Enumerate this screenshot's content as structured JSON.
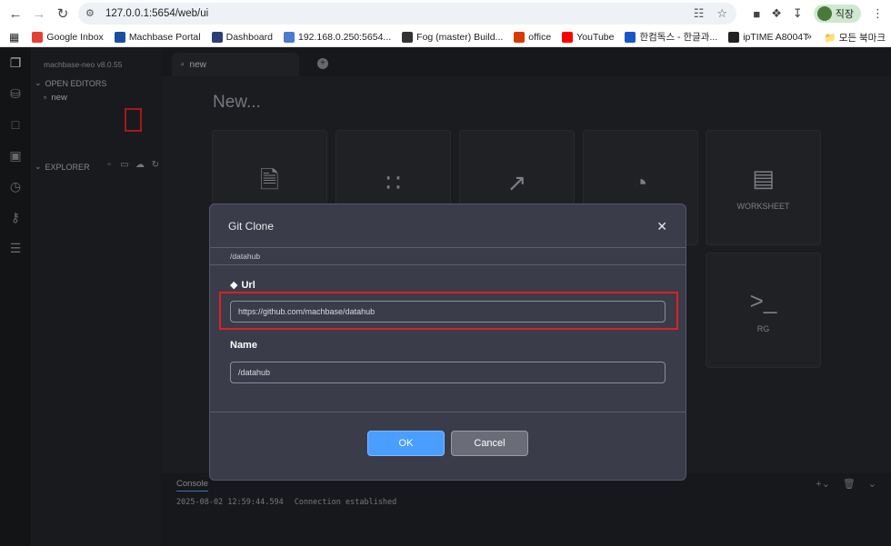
{
  "browser": {
    "url": "127.0.0.1:5654/web/ui",
    "profile_label": "직장",
    "bookmarks": [
      {
        "label": "Google Inbox",
        "color": "#e44134"
      },
      {
        "label": "Machbase Portal",
        "color": "#1a4fa0"
      },
      {
        "label": "Dashboard",
        "color": "#2c3e78"
      },
      {
        "label": "192.168.0.250:5654...",
        "color": "#4a7bd0"
      },
      {
        "label": "Fog (master) Build...",
        "color": "#333333"
      },
      {
        "label": "office",
        "color": "#d83b01"
      },
      {
        "label": "YouTube",
        "color": "#ff0000"
      },
      {
        "label": "한컴독스 - 한글과...",
        "color": "#1a56c7"
      },
      {
        "label": "ipTIME A8004T",
        "color": "#222222"
      }
    ],
    "bookmarks_more": "»",
    "all_bookmarks": "모든 북마크"
  },
  "sidebar": {
    "app_version": "machbase-neo v8.0.55",
    "open_editors_label": "OPEN EDITORS",
    "open_file": "new",
    "explorer_label": "EXPLORER"
  },
  "editor": {
    "tab_label": "new",
    "heading": "New...",
    "tiles": [
      {
        "label": "",
        "icon": "file-icon"
      },
      {
        "label": "",
        "icon": "scatter-icon"
      },
      {
        "label": "",
        "icon": "line-chart-icon"
      },
      {
        "label": "",
        "icon": "gauge-icon"
      },
      {
        "label": "WORKSHEET",
        "icon": "notebook-icon"
      },
      {
        "label": "RG",
        "icon": "terminal-icon"
      }
    ]
  },
  "console": {
    "tab_label": "Console",
    "log": [
      {
        "time": "2025-08-02 12:59:44.594",
        "message": "Connection established"
      }
    ]
  },
  "dialog": {
    "title": "Git Clone",
    "path": "/datahub",
    "url_label": "Url",
    "url_value": "https://github.com/machbase/datahub",
    "name_label": "Name",
    "name_value": "/datahub",
    "ok_label": "OK",
    "cancel_label": "Cancel"
  }
}
